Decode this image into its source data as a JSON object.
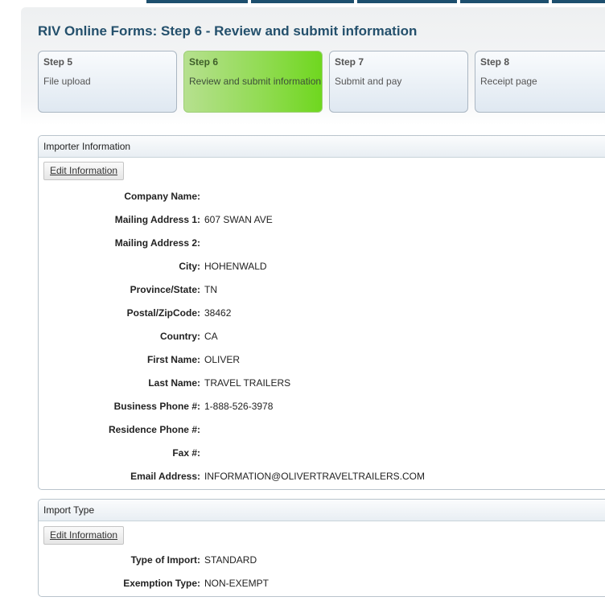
{
  "page": {
    "title": "RIV Online Forms: Step 6 - Review and submit information"
  },
  "steps": [
    {
      "num": "Step 5",
      "desc": "File upload",
      "active": false
    },
    {
      "num": "Step 6",
      "desc": "Review and submit information",
      "active": true
    },
    {
      "num": "Step 7",
      "desc": "Submit and pay",
      "active": false
    },
    {
      "num": "Step 8",
      "desc": "Receipt page",
      "active": false
    }
  ],
  "importer": {
    "heading": "Importer Information",
    "edit_label": "Edit Information",
    "fields": [
      {
        "label": "Company Name:",
        "value": ""
      },
      {
        "label": "Mailing Address 1:",
        "value": "607 SWAN AVE"
      },
      {
        "label": "Mailing Address 2:",
        "value": ""
      },
      {
        "label": "City:",
        "value": "HOHENWALD"
      },
      {
        "label": "Province/State:",
        "value": "TN"
      },
      {
        "label": "Postal/ZipCode:",
        "value": "38462"
      },
      {
        "label": "Country:",
        "value": "CA"
      },
      {
        "label": "First Name:",
        "value": "OLIVER"
      },
      {
        "label": "Last Name:",
        "value": "TRAVEL TRAILERS"
      },
      {
        "label": "Business Phone #:",
        "value": "1-888-526-3978"
      },
      {
        "label": "Residence Phone #:",
        "value": ""
      },
      {
        "label": "Fax #:",
        "value": ""
      },
      {
        "label": "Email Address:",
        "value": "INFORMATION@OLIVERTRAVELTRAILERS.COM"
      }
    ]
  },
  "import_type": {
    "heading": "Import Type",
    "edit_label": "Edit Information",
    "fields": [
      {
        "label": "Type of Import:",
        "value": "STANDARD"
      },
      {
        "label": "Exemption Type:",
        "value": "NON-EXEMPT"
      }
    ]
  }
}
